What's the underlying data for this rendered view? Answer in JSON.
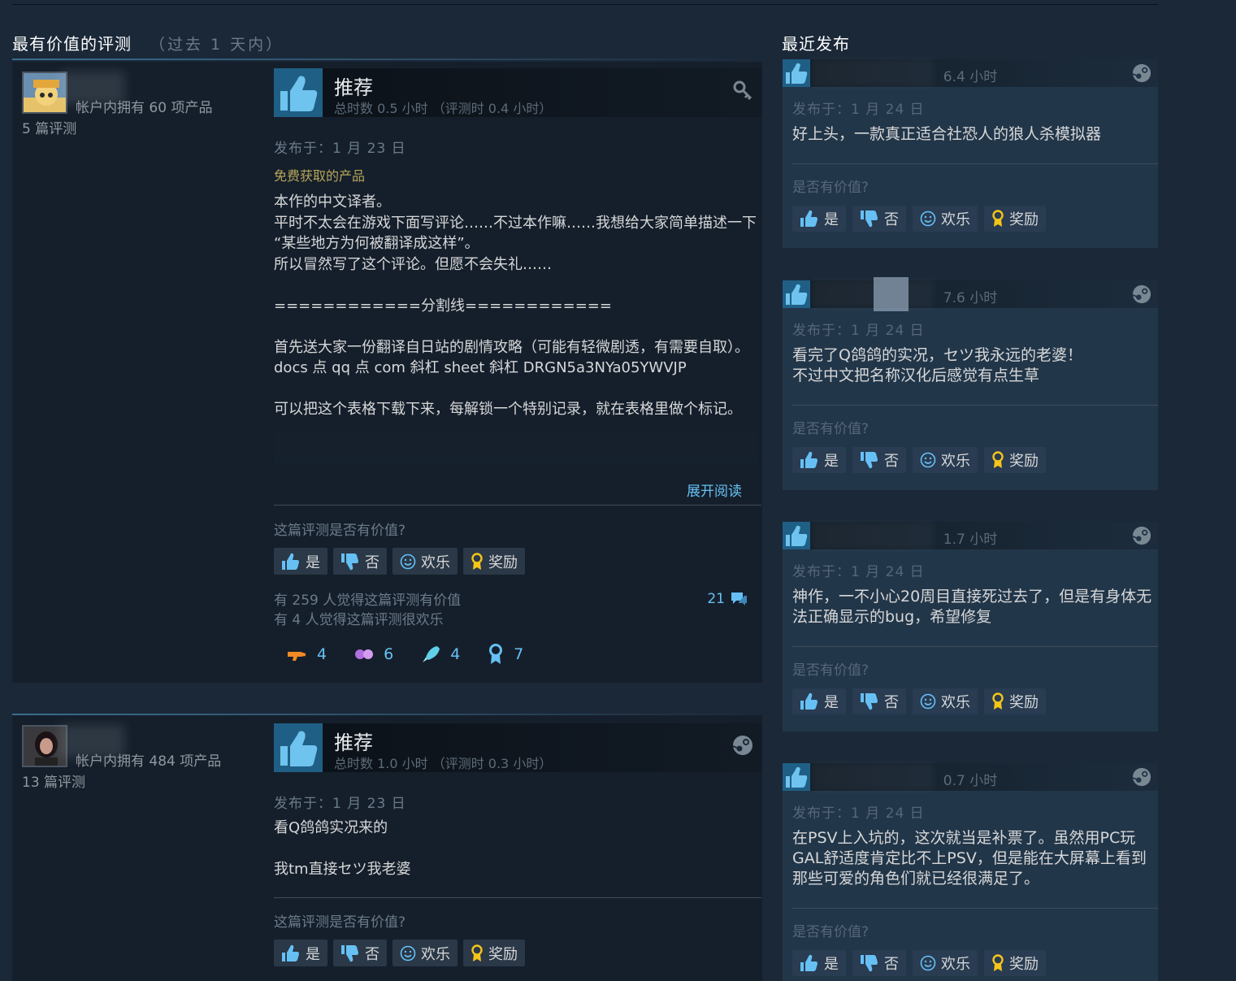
{
  "left_section": {
    "title": "最有价值的评测",
    "period": "（过去 1 天内）"
  },
  "right_section": {
    "title": "最近发布"
  },
  "reviews": [
    {
      "owned": "帐户内拥有 60 项产品",
      "review_count": "5 篇评测",
      "verdict": "推荐",
      "hours": "总时数 0.5 小时 （评测时 0.4 小时）",
      "posted": "发布于：1 月 23 日",
      "free_tag": "免费获取的产品",
      "content": "本作的中文译者。\n平时不太会在游戏下面写评论……不过本作嘛……我想给大家简单描述一下 “某些地方为何被翻译成这样”。\n所以冒然写了这个评论。但愿不会失礼……\n\n============分割线============\n\n首先送大家一份翻译自日站的剧情攻略（可能有轻微剧透，有需要自取）。\ndocs 点 qq 点 com 斜杠 sheet 斜杠 DRGN5a3NYa05YWVJP\n\n可以把这个表格下载下来，每解锁一个特别记录，就在表格里做个标记。",
      "expand": "展开阅读",
      "helpful_q": "这篇评测是否有价值?",
      "buttons": {
        "yes": "是",
        "no": "否",
        "funny": "欢乐",
        "award": "奖励"
      },
      "helpful_stat": "有 259 人觉得这篇评测有价值",
      "funny_stat": "有 4 人觉得这篇评测很欢乐",
      "comments": "21",
      "awards": [
        "4",
        "6",
        "4",
        "7"
      ]
    },
    {
      "owned": "帐户内拥有 484 项产品",
      "review_count": "13 篇评测",
      "verdict": "推荐",
      "hours": "总时数 1.0 小时 （评测时 0.3 小时）",
      "posted": "发布于：1 月 23 日",
      "content": "看Q鸽鸽实况来的\n\n我tm直接セツ我老婆",
      "helpful_q": "这篇评测是否有价值?",
      "buttons": {
        "yes": "是",
        "no": "否",
        "funny": "欢乐",
        "award": "奖励"
      }
    }
  ],
  "recent": [
    {
      "hours": "6.4 小时",
      "posted": "发布于：1 月 24 日",
      "content": "好上头，一款真正适合社恐人的狼人杀模拟器",
      "helpful_q": "是否有价值?",
      "buttons": {
        "yes": "是",
        "no": "否",
        "funny": "欢乐",
        "award": "奖励"
      }
    },
    {
      "hours": "7.6 小时",
      "posted": "发布于：1 月 24 日",
      "content": "看完了Q鸽鸽的实况，セツ我永远的老婆！\n不过中文把名称汉化后感觉有点生草",
      "helpful_q": "是否有价值?",
      "buttons": {
        "yes": "是",
        "no": "否",
        "funny": "欢乐",
        "award": "奖励"
      }
    },
    {
      "hours": "1.7 小时",
      "posted": "发布于：1 月 24 日",
      "content": "神作，一不小心20周目直接死过去了，但是有身体无法正确显示的bug，希望修复",
      "helpful_q": "是否有价值?",
      "buttons": {
        "yes": "是",
        "no": "否",
        "funny": "欢乐",
        "award": "奖励"
      }
    },
    {
      "hours": "0.7 小时",
      "posted": "发布于：1 月 24 日",
      "content": "在PSV上入坑的，这次就当是补票了。虽然用PC玩GAL舒适度肯定比不上PSV，但是能在大屏幕上看到那些可爱的角色们就已经很满足了。",
      "helpful_q": "是否有价值?",
      "buttons": {
        "yes": "是",
        "no": "否",
        "funny": "欢乐",
        "award": "奖励"
      }
    }
  ],
  "colors": {
    "background": "#1b2838",
    "link": "#66c0f4",
    "free_tag": "#b6a55a",
    "thumb_box": "#1f5f86"
  }
}
